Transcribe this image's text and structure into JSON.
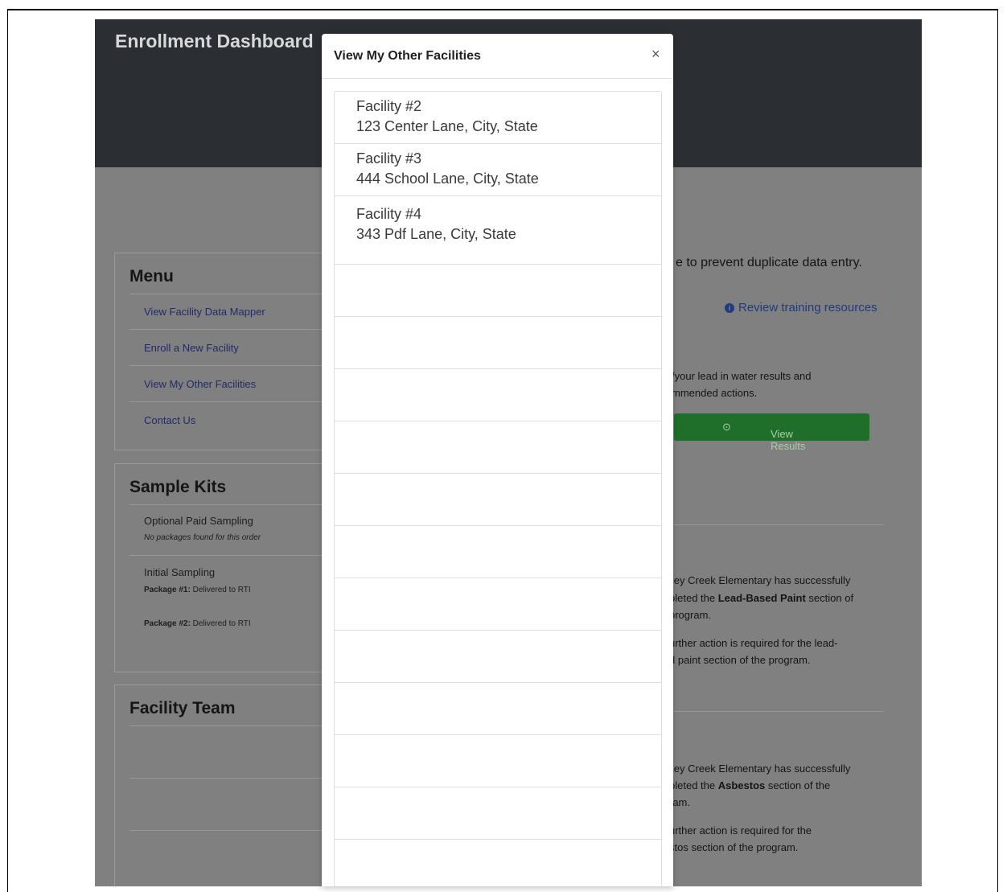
{
  "app": {
    "title": "Enrollment Dashboard",
    "menu": {
      "title": "Menu",
      "items": [
        "View Facility Data Mapper",
        "Enroll a New Facility",
        "View My Other Facilities",
        "Contact Us"
      ]
    },
    "sample_kits": {
      "title": "Sample Kits",
      "optional": {
        "title": "Optional Paid Sampling",
        "note": "No packages found for this order"
      },
      "initial": {
        "title": "Initial Sampling",
        "packages": [
          {
            "label": "Package #1:",
            "status": "Delivered to RTI"
          },
          {
            "label": "Package #2:",
            "status": "Delivered to RTI"
          }
        ]
      }
    },
    "facility_team": {
      "title": "Facility Team"
    },
    "duplicate_note": "e to prevent duplicate data entry.",
    "training_link": "Review training resources",
    "results_text": [
      "/your lead in water results and",
      "mmended actions."
    ],
    "view_results_label": "View Results",
    "lead_paint": {
      "line1": "lley Creek Elementary has successfully",
      "line2_prefix": "pleted the ",
      "line2_bold": "Lead-Based Paint",
      "line2_suffix": " section of",
      "line3": "program.",
      "line4": "urther action is required for the lead-",
      "line5": "d paint section of the program."
    },
    "asbestos": {
      "line1": "lley Creek Elementary has successfully",
      "line2_prefix": "pleted the ",
      "line2_bold": "Asbestos",
      "line2_suffix": " section of the",
      "line3": "ram.",
      "line4": "urther action is required for the",
      "line5": "stos section of the program."
    }
  },
  "modal": {
    "title": "View My Other Facilities",
    "close": "×",
    "facilities": [
      {
        "name": "Facility #2",
        "address": "123 Center Lane, City, State"
      },
      {
        "name": "Facility #3",
        "address": "444 School Lane, City, State"
      },
      {
        "name": "Facility #4",
        "address": "343 Pdf Lane, City, State"
      }
    ]
  }
}
